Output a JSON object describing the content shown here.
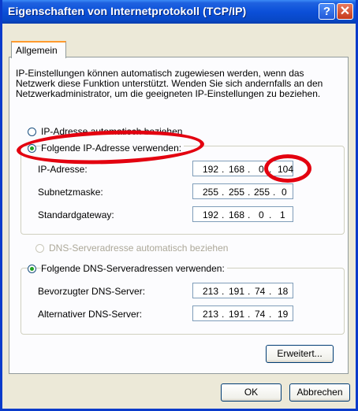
{
  "window": {
    "title": "Eigenschaften von Internetprotokoll (TCP/IP)",
    "help_glyph": "?",
    "close_glyph": "✕"
  },
  "tabs": [
    {
      "label": "Allgemein"
    }
  ],
  "intro": "IP-Einstellungen können automatisch zugewiesen werden, wenn das Netzwerk diese Funktion unterstützt. Wenden Sie sich andernfalls an den Netzwerkadministrator, um die geeigneten IP-Einstellungen zu beziehen.",
  "ip_options": {
    "auto": {
      "label": "IP-Adresse automatisch beziehen",
      "selected": false
    },
    "manual": {
      "label": "Folgende IP-Adresse verwenden:",
      "selected": true
    }
  },
  "ip_fields": [
    {
      "label": "IP-Adresse:",
      "octets": [
        "192",
        "168",
        "0",
        "104"
      ]
    },
    {
      "label": "Subnetzmaske:",
      "octets": [
        "255",
        "255",
        "255",
        "0"
      ]
    },
    {
      "label": "Standardgateway:",
      "octets": [
        "192",
        "168",
        "0",
        "1"
      ]
    }
  ],
  "dns_options": {
    "auto": {
      "label": "DNS-Serveradresse automatisch beziehen",
      "selected": false,
      "enabled": false
    },
    "manual": {
      "label": "Folgende DNS-Serveradressen verwenden:",
      "selected": true
    }
  },
  "dns_fields": [
    {
      "label": "Bevorzugter DNS-Server:",
      "octets": [
        "213",
        "191",
        "74",
        "18"
      ]
    },
    {
      "label": "Alternativer DNS-Server:",
      "octets": [
        "213",
        "191",
        "74",
        "19"
      ]
    }
  ],
  "buttons": {
    "advanced": "Erweitert...",
    "ok": "OK",
    "cancel": "Abbrechen"
  },
  "colors": {
    "title_bar": "#0b4fd8",
    "annotation_red": "#e3000f",
    "selected_radio": "#21a121",
    "dialog_bg": "#ece9d8"
  }
}
